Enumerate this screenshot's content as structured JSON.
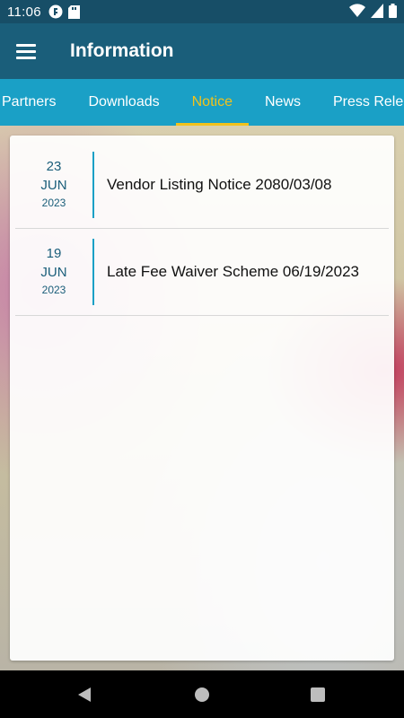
{
  "status_bar": {
    "time": "11:06"
  },
  "app_bar": {
    "title": "Information"
  },
  "tabs": [
    {
      "label": "Partners",
      "active": false
    },
    {
      "label": "Downloads",
      "active": false
    },
    {
      "label": "Notice",
      "active": true
    },
    {
      "label": "News",
      "active": false
    },
    {
      "label": "Press Releas",
      "active": false
    }
  ],
  "notices": [
    {
      "day": "23",
      "month": "JUN",
      "year": "2023",
      "title": "Vendor Listing Notice 2080/03/08"
    },
    {
      "day": "19",
      "month": "JUN",
      "year": "2023",
      "title": "Late Fee Waiver Scheme 06/19/2023"
    }
  ],
  "colors": {
    "primary": "#1a5e7a",
    "tab_bar": "#1aa0c6",
    "accent": "#f2c21b"
  }
}
